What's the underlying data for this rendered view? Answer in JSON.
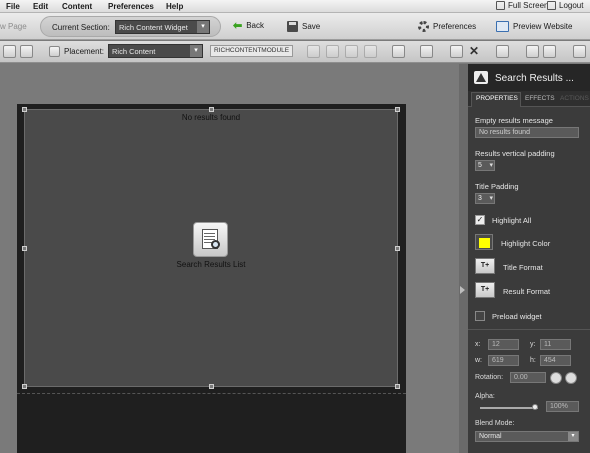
{
  "menu": {
    "file": "File",
    "edit": "Edit",
    "content": "Content",
    "preferences": "Preferences",
    "help": "Help",
    "full_screen": "Full Screen",
    "logout": "Logout"
  },
  "toolbar": {
    "new_page": "w Page",
    "current_section_label": "Current Section:",
    "current_section_value": "Rich Content Widget",
    "back": "Back",
    "save": "Save",
    "preferences": "Preferences",
    "preview_website": "Preview Website"
  },
  "toolbar2": {
    "placement_label": "Placement:",
    "placement_value": "Rich Content",
    "module_tag": "RICHCONTENTMODULE"
  },
  "canvas": {
    "empty_message": "No results found",
    "widget_label": "Search Results List"
  },
  "panel": {
    "title": "Search Results ...",
    "tabs": [
      "PROPERTIES",
      "EFFECTS",
      "ACTIONS"
    ],
    "empty_results_label": "Empty results message",
    "empty_results_value": "No results found",
    "vertical_padding_label": "Results vertical padding",
    "vertical_padding_value": "5",
    "title_padding_label": "Title Padding",
    "title_padding_value": "3",
    "highlight_all": "Highlight All",
    "highlight_all_checked": true,
    "highlight_color_label": "Highlight Color",
    "highlight_color": "#ffff00",
    "title_format": "Title Format",
    "result_format": "Result Format",
    "preload_widget": "Preload widget",
    "preload_checked": false,
    "x_label": "x:",
    "x_value": "12",
    "y_label": "y:",
    "y_value": "11",
    "w_label": "w:",
    "w_value": "619",
    "h_label": "h:",
    "h_value": "454",
    "rotation_label": "Rotation:",
    "rotation_value": "0.00",
    "alpha_label": "Alpha:",
    "alpha_value": "100%",
    "alpha_fraction": 1.0,
    "blend_mode_label": "Blend Mode:",
    "blend_mode_value": "Normal"
  }
}
